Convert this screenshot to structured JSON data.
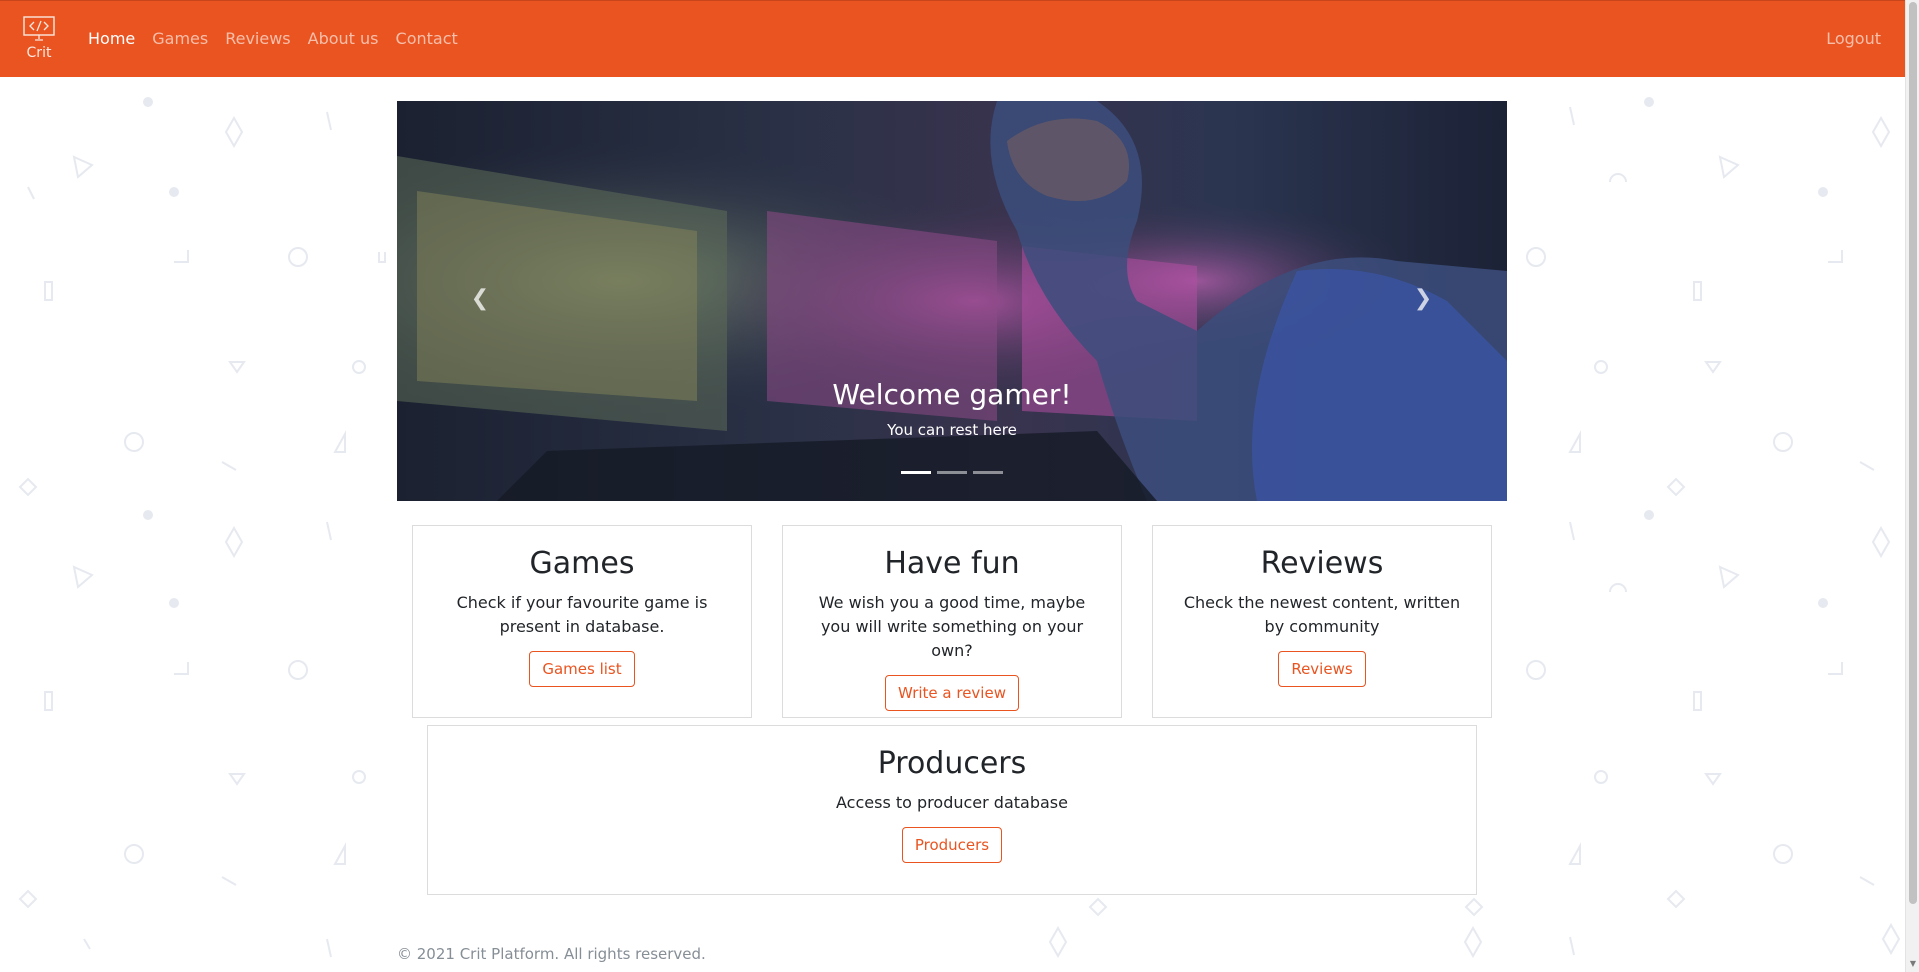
{
  "brand": {
    "label": "Crit",
    "icon": "code-monitor-icon"
  },
  "nav": {
    "links": [
      {
        "label": "Home",
        "active": true
      },
      {
        "label": "Games",
        "active": false
      },
      {
        "label": "Reviews",
        "active": false
      },
      {
        "label": "About us",
        "active": false
      },
      {
        "label": "Contact",
        "active": false
      }
    ],
    "logout_label": "Logout"
  },
  "carousel": {
    "title": "Welcome gamer!",
    "subtitle": "You can rest here",
    "prev_icon": "chevron-left-icon",
    "next_icon": "chevron-right-icon",
    "slide_count": 3,
    "active_slide": 1
  },
  "cards": [
    {
      "title": "Games",
      "text": "Check if your favourite game is present in database.",
      "button": "Games list"
    },
    {
      "title": "Have fun",
      "text": "We wish you a good time, maybe you will write something on your own?",
      "button": "Write a review"
    },
    {
      "title": "Reviews",
      "text": "Check the newest content, written by community",
      "button": "Reviews"
    }
  ],
  "producers_card": {
    "title": "Producers",
    "text": "Access to producer database",
    "button": "Producers"
  },
  "footer": {
    "text": "© 2021 Crit Platform. All rights reserved."
  },
  "colors": {
    "accent": "#e95420",
    "text": "#212529",
    "muted": "#868e96"
  }
}
